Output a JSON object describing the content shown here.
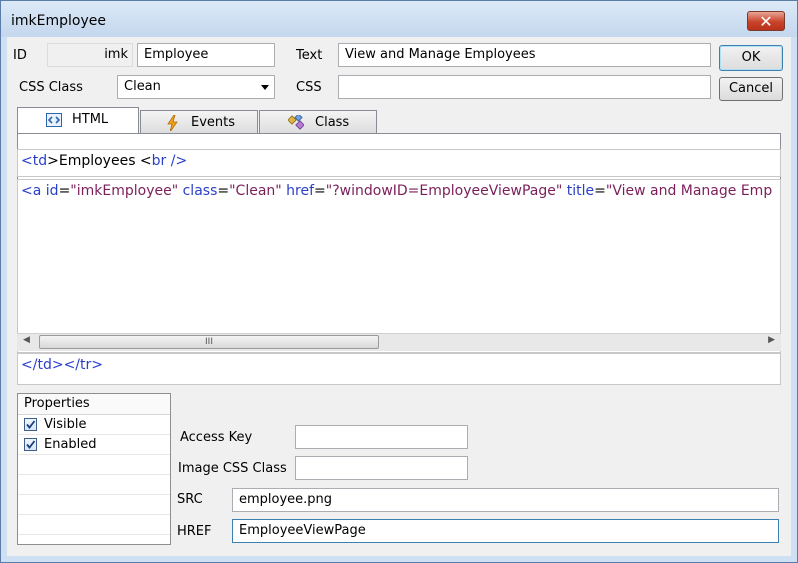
{
  "window": {
    "title": "imkEmployee",
    "close_glyph": "✕"
  },
  "form": {
    "id_label": "ID",
    "id_prefix": "imk",
    "id_value": "Employee",
    "text_label": "Text",
    "text_value": "View and Manage Employees",
    "css_class_label": "CSS Class",
    "css_class_value": "Clean",
    "css_label": "CSS",
    "css_value": ""
  },
  "buttons": {
    "ok": "OK",
    "cancel": "Cancel"
  },
  "tabs": [
    {
      "label": "HTML",
      "icon": "html-code-icon",
      "active": true
    },
    {
      "label": "Events",
      "icon": "lightning-icon",
      "active": false
    },
    {
      "label": "Class",
      "icon": "class-icon",
      "active": false
    }
  ],
  "html_editor": {
    "before_open": "<",
    "before_tag": "td",
    "before_mid": ">Employees <",
    "before_br": "br",
    "before_close": " />",
    "main": {
      "lt": "<",
      "tag": "a",
      "attr_id": "id",
      "val_id": "\"imkEmployee\"",
      "attr_class": "class",
      "val_class": "\"Clean\"",
      "attr_href": "href",
      "val_href": "\"?windowID=EmployeeViewPage\"",
      "attr_title": "title",
      "val_title": "\"View and Manage Emp"
    },
    "after_lt1": "</",
    "after_tag1": "td",
    "after_mid": "></",
    "after_tag2": "tr",
    "after_gt": ">",
    "scroll_grip": "III"
  },
  "properties": {
    "header": "Properties",
    "items": [
      {
        "label": "Visible",
        "checked": true
      },
      {
        "label": "Enabled",
        "checked": true
      }
    ]
  },
  "fields": {
    "access_key_label": "Access Key",
    "access_key_value": "",
    "image_css_label": "Image CSS Class",
    "image_css_value": "",
    "src_label": "SRC",
    "src_value": "employee.png",
    "href_label": "HREF",
    "href_value": "EmployeeViewPage"
  }
}
